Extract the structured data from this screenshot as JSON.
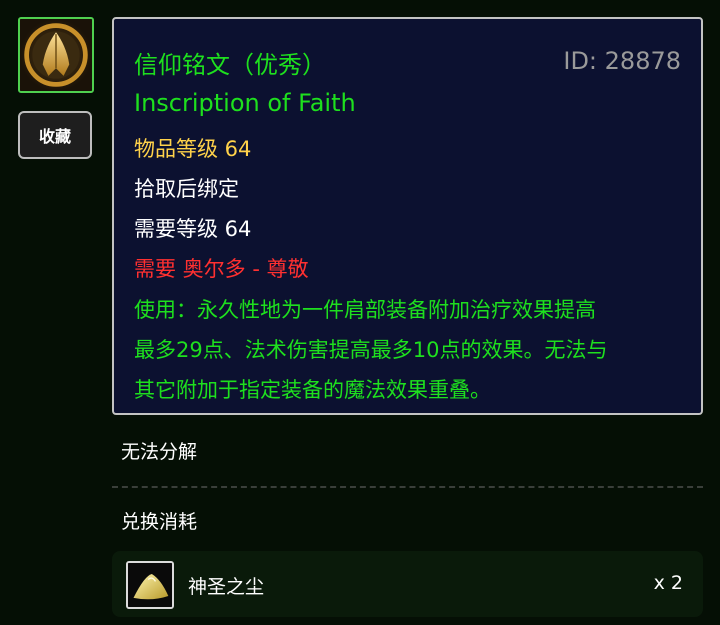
{
  "sidebar": {
    "item_icon": "praying-hands-icon",
    "favorite_label": "收藏"
  },
  "tooltip": {
    "name_cn": "信仰铭文（优秀）",
    "id_text": "ID: 28878",
    "name_en": "Inscription of Faith",
    "item_level": "物品等级 64",
    "bind": "拾取后绑定",
    "required_level": "需要等级 64",
    "required_reputation": "需要 奥尔多 - 尊敬",
    "use_line1": "使用：永久性地为一件肩部装备附加治疗效果提高",
    "use_line2": "最多29点、法术伤害提高最多10点的效果。无法与",
    "use_line3": "其它附加于指定装备的魔法效果重叠。"
  },
  "disenchant_text": "无法分解",
  "exchange": {
    "title": "兑换消耗",
    "items": [
      {
        "icon": "holy-dust-icon",
        "name": "神圣之尘",
        "quantity": "x 2"
      }
    ]
  },
  "colors": {
    "quality_green": "#1ee01e",
    "item_level_yellow": "#ffd24a",
    "requirement_red": "#ff3030",
    "tooltip_bg": "#0c1130"
  }
}
